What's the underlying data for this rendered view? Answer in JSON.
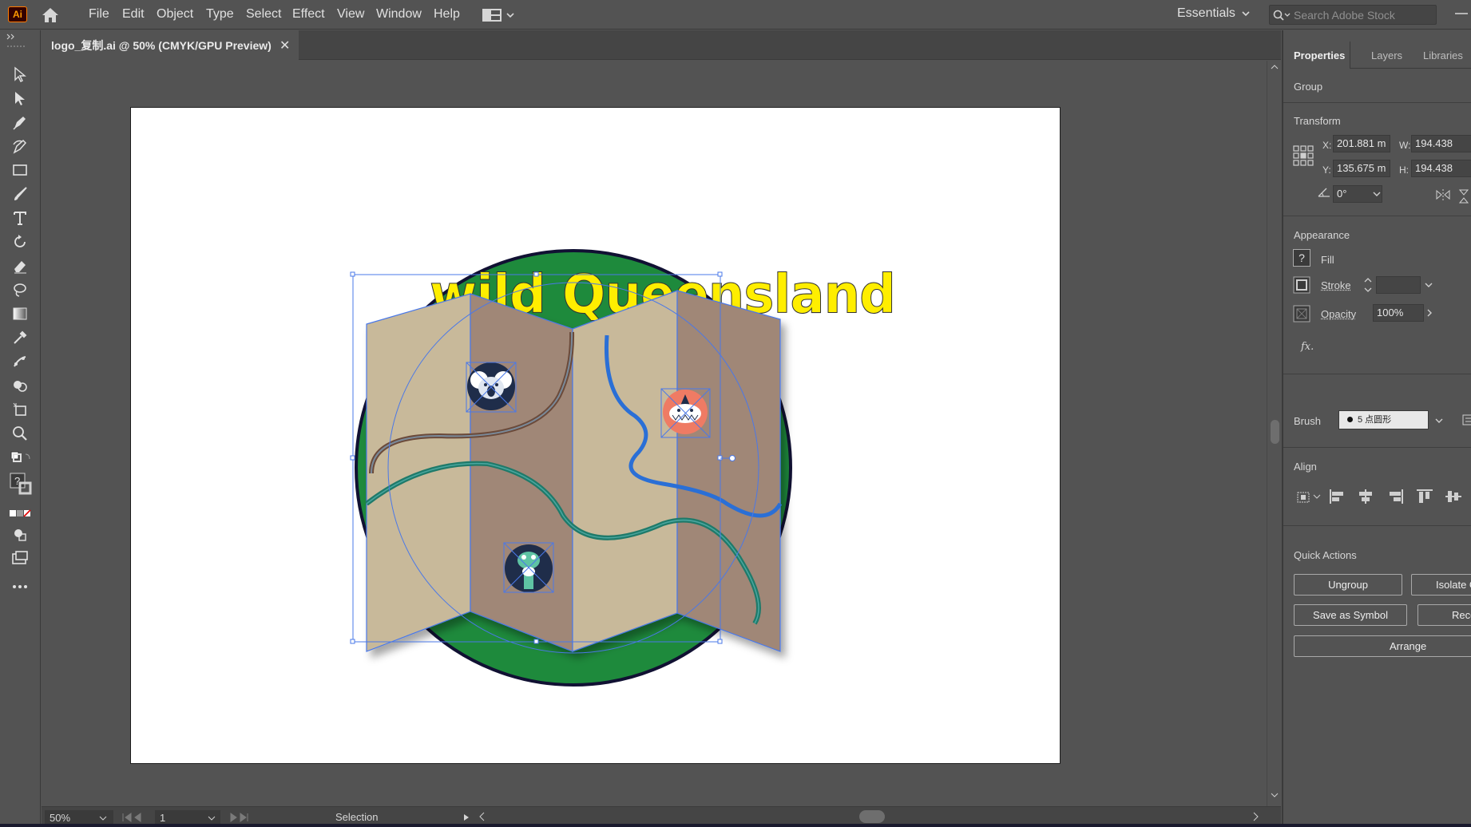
{
  "app": {
    "logo_text": "Ai",
    "menu": [
      "File",
      "Edit",
      "Object",
      "Type",
      "Select",
      "Effect",
      "View",
      "Window",
      "Help"
    ],
    "workspace": "Essentials",
    "search_placeholder": "Search Adobe Stock"
  },
  "document": {
    "tab_title": "logo_复制.ai @ 50% (CMYK/GPU Preview)",
    "close_glyph": "✕"
  },
  "artwork": {
    "title_text": "wild Queensland",
    "colors": {
      "badge_green": "#1e8a3c",
      "title_yellow": "#ffee00",
      "map_light": "#c8b99a",
      "map_dark": "#a08777",
      "river_blue": "#2a6fd6",
      "river_teal": "#1f7a6a",
      "selection_blue": "#4a78e8"
    }
  },
  "status": {
    "zoom": "50%",
    "artboard_number": "1",
    "current_tool": "Selection"
  },
  "panel": {
    "tabs": [
      "Properties",
      "Layers",
      "Libraries"
    ],
    "selection_type": "Group",
    "transform": {
      "title": "Transform",
      "x_label": "X:",
      "x_value": "201.881 m",
      "y_label": "Y:",
      "y_value": "135.675 m",
      "w_label": "W:",
      "w_value": "194.438",
      "h_label": "H:",
      "h_value": "194.438",
      "angle_value": "0°"
    },
    "appearance": {
      "title": "Appearance",
      "fill_label": "Fill",
      "stroke_label": "Stroke",
      "opacity_label": "Opacity",
      "opacity_value": "100%",
      "fx_label": "fx."
    },
    "brush": {
      "label": "Brush",
      "value": "5 点圆形"
    },
    "align": {
      "title": "Align"
    },
    "quick_actions": {
      "title": "Quick Actions",
      "ungroup": "Ungroup",
      "isolate": "Isolate G",
      "save_symbol": "Save as Symbol",
      "recolor": "Reco",
      "arrange": "Arrange"
    }
  }
}
